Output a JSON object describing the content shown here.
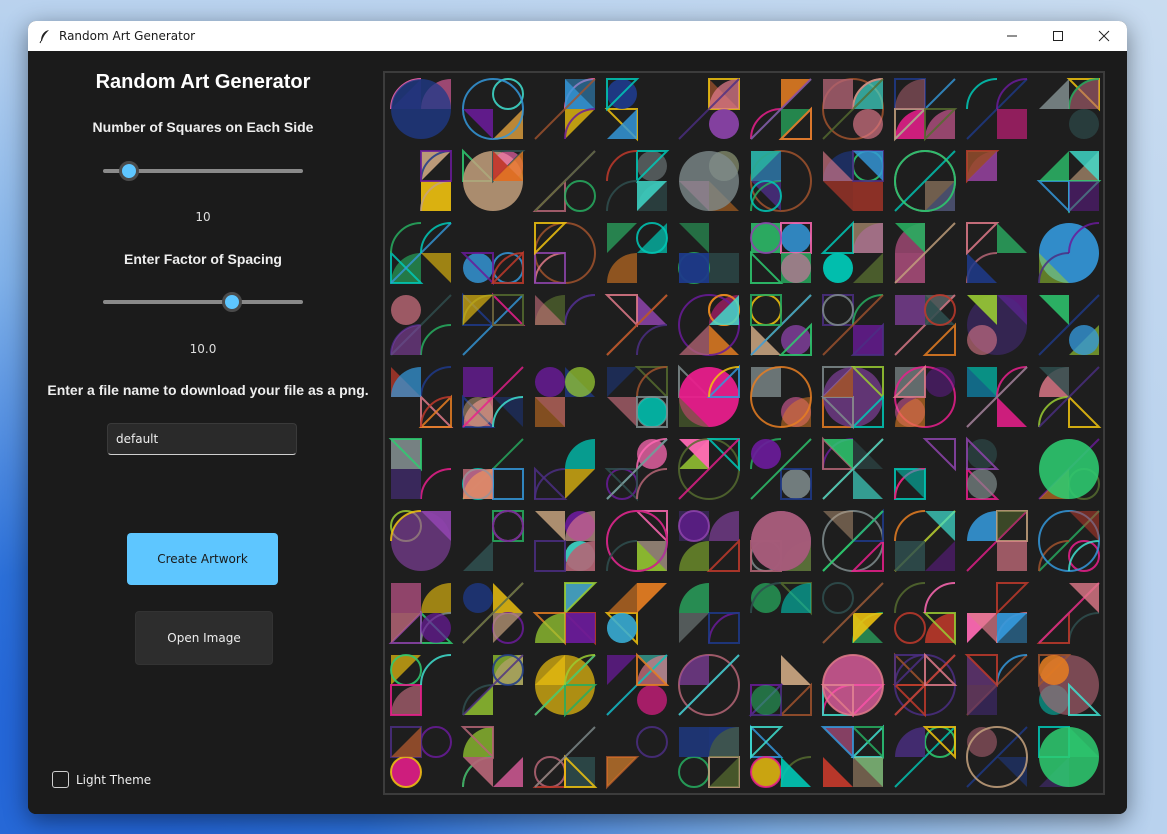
{
  "window": {
    "title": "Random Art Generator"
  },
  "panel": {
    "heading": "Random Art Generator",
    "squares": {
      "label": "Number of Squares on Each Side",
      "value": "10",
      "fraction": 0.13
    },
    "spacing": {
      "label": "Enter Factor of Spacing",
      "value": "10.0",
      "fraction": 0.645
    },
    "file": {
      "label": "Enter a file name to download your file as a png.",
      "value": "default"
    },
    "create_label": "Create Artwork",
    "open_label": "Open Image",
    "theme_label": "Light Theme"
  },
  "colors": {
    "accent": "#5ec6ff",
    "panel_bg": "#1b1b1b",
    "canvas_bg": "#1e1e1e",
    "art_palette": [
      "#c0392b",
      "#e91e8c",
      "#8e44ad",
      "#6a1b9a",
      "#2ecc71",
      "#27ae60",
      "#3498db",
      "#1e3a8a",
      "#00c9b7",
      "#9acd32",
      "#f1c40f",
      "#e67e22",
      "#c6a27e",
      "#e07a8a",
      "#7f8c8d",
      "#556b2f",
      "#4b2e83",
      "#a0522d",
      "#40e0d0",
      "#ff69b4",
      "#2f4f4f",
      "#b56576"
    ]
  }
}
